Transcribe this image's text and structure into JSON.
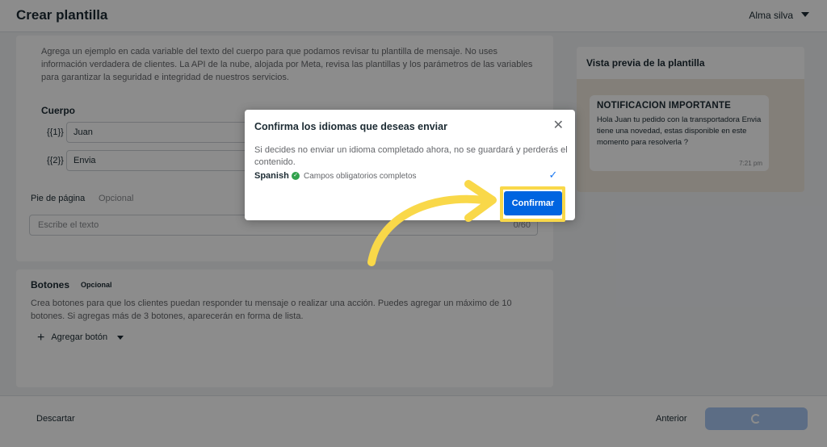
{
  "header": {
    "title": "Crear plantilla",
    "user_name": "Alma silva"
  },
  "body_card": {
    "intro": "Agrega un ejemplo en cada variable del texto del cuerpo para que podamos revisar tu plantilla de mensaje. No uses información verdadera de clientes. La API de la nube, alojada por Meta, revisa las plantillas y los parámetros de las variables para garantizar la seguridad e integridad de nuestros servicios.",
    "section_title": "Cuerpo",
    "variables": [
      {
        "tag": "{{1}}",
        "value": "Juan"
      },
      {
        "tag": "{{2}}",
        "value": "Envia"
      }
    ],
    "footer_label": "Pie de página",
    "footer_optional": "Opcional",
    "footer_placeholder": "Escribe el texto",
    "footer_counter": "0/60"
  },
  "buttons_card": {
    "title": "Botones",
    "optional": "Opcional",
    "description": "Crea botones para que los clientes puedan responder tu mensaje o realizar una acción. Puedes agregar un máximo de 10 botones. Si agregas más de 3 botones, aparecerán en forma de lista.",
    "add_button": "Agregar botón"
  },
  "preview": {
    "title": "Vista previa de la plantilla",
    "message_header": "NOTIFICACION IMPORTANTE",
    "message_body": "Hola Juan tu pedido con la transportadora Envia tiene una novedad, estas disponible en este momento para resolverla ?",
    "message_time": "7:21 pm"
  },
  "bottom_bar": {
    "discard": "Descartar",
    "previous": "Anterior"
  },
  "modal": {
    "title": "Confirma los idiomas que deseas enviar",
    "close_glyph": "✕",
    "description": "Si decides no enviar un idioma completado ahora, no se guardará y perderás el contenido.",
    "language": "Spanish",
    "language_status": "Campos obligatorios completos",
    "language_checked": true,
    "confirm": "Confirmar"
  },
  "colors": {
    "accent": "#0064e0",
    "highlight": "#f9d849",
    "success": "#31a24c"
  }
}
